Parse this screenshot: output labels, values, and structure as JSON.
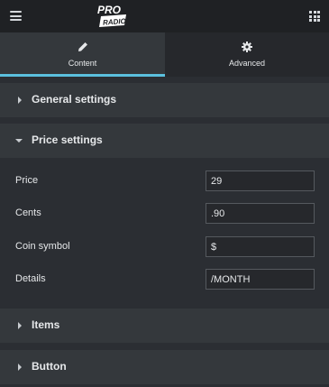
{
  "topbar": {
    "menu_icon": "hamburger-icon",
    "apps_icon": "grid-icon",
    "logo_text_top": "PRO",
    "logo_text_bottom": "RADIO"
  },
  "tabs": [
    {
      "label": "Content",
      "icon": "pencil-icon",
      "active": true
    },
    {
      "label": "Advanced",
      "icon": "gear-icon",
      "active": false
    }
  ],
  "sections": {
    "general": {
      "title": "General settings",
      "expanded": false
    },
    "price": {
      "title": "Price settings",
      "expanded": true
    },
    "items": {
      "title": "Items",
      "expanded": false
    },
    "button": {
      "title": "Button",
      "expanded": false
    }
  },
  "price_fields": [
    {
      "label": "Price",
      "value": "29"
    },
    {
      "label": "Cents",
      "value": ".90"
    },
    {
      "label": "Coin symbol",
      "value": "$"
    },
    {
      "label": "Details",
      "value": "/MONTH"
    }
  ],
  "colors": {
    "accent": "#5bc0de",
    "panel": "#34383c",
    "background": "#2b2e33",
    "topbar": "#1f2124"
  }
}
